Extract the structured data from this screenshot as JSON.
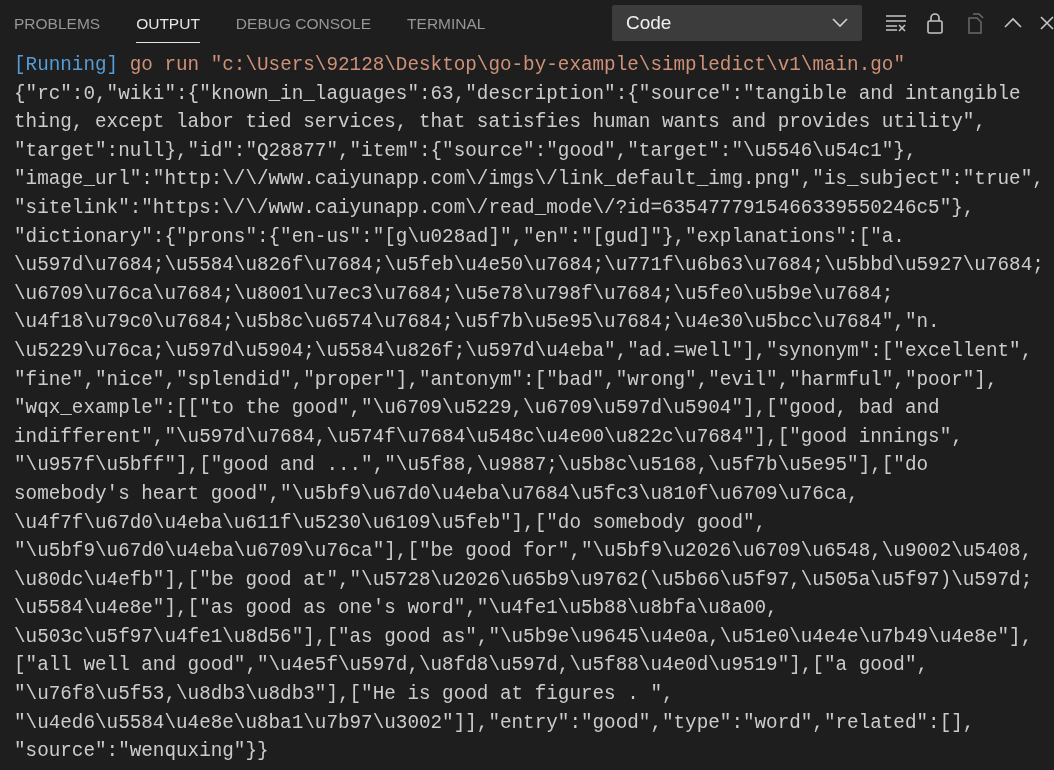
{
  "panel_tabs": [
    {
      "label": "PROBLEMS",
      "selected": false
    },
    {
      "label": "OUTPUT",
      "selected": true
    },
    {
      "label": "DEBUG CONSOLE",
      "selected": false
    },
    {
      "label": "TERMINAL",
      "selected": false
    }
  ],
  "channel_dropdown": {
    "value": "Code"
  },
  "output": {
    "lines": [
      {
        "kind": "running",
        "tag": "[Running]",
        "text": "go run \"c:\\Users\\92128\\Desktop\\go-by-example\\simpledict\\v1\\main.go\""
      },
      {
        "kind": "plain",
        "text": "{\"rc\":0,\"wiki\":{\"known_in_laguages\":63,\"description\":{\"source\":\"tangible and intangible"
      },
      {
        "kind": "plain",
        "text": "thing, except labor tied services, that satisfies human wants and provides utility\","
      },
      {
        "kind": "plain",
        "text": "\"target\":null},\"id\":\"Q28877\",\"item\":{\"source\":\"good\",\"target\":\"\\u5546\\u54c1\"},"
      },
      {
        "kind": "plain",
        "text": "\"image_url\":\"http:\\/\\/www.caiyunapp.com\\/imgs\\/link_default_img.png\",\"is_subject\":\"true\","
      },
      {
        "kind": "plain",
        "text": "\"sitelink\":\"https:\\/\\/www.caiyunapp.com\\/read_mode\\/?id=6354777915466339550246c5\"},"
      },
      {
        "kind": "plain",
        "text": "\"dictionary\":{\"prons\":{\"en-us\":\"[g\\u028ad]\",\"en\":\"[gud]\"},\"explanations\":[\"a."
      },
      {
        "kind": "plain",
        "text": "\\u597d\\u7684;\\u5584\\u826f\\u7684;\\u5feb\\u4e50\\u7684;\\u771f\\u6b63\\u7684;\\u5bbd\\u5927\\u7684;"
      },
      {
        "kind": "plain",
        "text": "\\u6709\\u76ca\\u7684;\\u8001\\u7ec3\\u7684;\\u5e78\\u798f\\u7684;\\u5fe0\\u5b9e\\u7684;"
      },
      {
        "kind": "plain",
        "text": "\\u4f18\\u79c0\\u7684;\\u5b8c\\u6574\\u7684;\\u5f7b\\u5e95\\u7684;\\u4e30\\u5bcc\\u7684\",\"n."
      },
      {
        "kind": "plain",
        "text": "\\u5229\\u76ca;\\u597d\\u5904;\\u5584\\u826f;\\u597d\\u4eba\",\"ad.=well\"],\"synonym\":[\"excellent\","
      },
      {
        "kind": "plain",
        "text": "\"fine\",\"nice\",\"splendid\",\"proper\"],\"antonym\":[\"bad\",\"wrong\",\"evil\",\"harmful\",\"poor\"],"
      },
      {
        "kind": "plain",
        "text": "\"wqx_example\":[[\"to the good\",\"\\u6709\\u5229,\\u6709\\u597d\\u5904\"],[\"good, bad and"
      },
      {
        "kind": "plain",
        "text": "indifferent\",\"\\u597d\\u7684,\\u574f\\u7684\\u548c\\u4e00\\u822c\\u7684\"],[\"good innings\","
      },
      {
        "kind": "plain",
        "text": "\"\\u957f\\u5bff\"],[\"good and ...\",\"\\u5f88,\\u9887;\\u5b8c\\u5168,\\u5f7b\\u5e95\"],[\"do"
      },
      {
        "kind": "plain",
        "text": "somebody's heart good\",\"\\u5bf9\\u67d0\\u4eba\\u7684\\u5fc3\\u810f\\u6709\\u76ca,"
      },
      {
        "kind": "plain",
        "text": "\\u4f7f\\u67d0\\u4eba\\u611f\\u5230\\u6109\\u5feb\"],[\"do somebody good\","
      },
      {
        "kind": "plain",
        "text": "\"\\u5bf9\\u67d0\\u4eba\\u6709\\u76ca\"],[\"be good for\",\"\\u5bf9\\u2026\\u6709\\u6548,\\u9002\\u5408,"
      },
      {
        "kind": "plain",
        "text": "\\u80dc\\u4efb\"],[\"be good at\",\"\\u5728\\u2026\\u65b9\\u9762(\\u5b66\\u5f97,\\u505a\\u5f97)\\u597d;"
      },
      {
        "kind": "plain",
        "text": "\\u5584\\u4e8e\"],[\"as good as one's word\",\"\\u4fe1\\u5b88\\u8bfa\\u8a00,"
      },
      {
        "kind": "plain",
        "text": "\\u503c\\u5f97\\u4fe1\\u8d56\"],[\"as good as\",\"\\u5b9e\\u9645\\u4e0a,\\u51e0\\u4e4e\\u7b49\\u4e8e\"],"
      },
      {
        "kind": "plain",
        "text": "[\"all well and good\",\"\\u4e5f\\u597d,\\u8fd8\\u597d,\\u5f88\\u4e0d\\u9519\"],[\"a good\","
      },
      {
        "kind": "plain",
        "text": "\"\\u76f8\\u5f53,\\u8db3\\u8db3\"],[\"He is good at figures . \","
      },
      {
        "kind": "plain",
        "text": "\"\\u4ed6\\u5584\\u4e8e\\u8ba1\\u7b97\\u3002\"]],\"entry\":\"good\",\"type\":\"word\",\"related\":[],"
      },
      {
        "kind": "plain",
        "text": "\"source\":\"wenquxing\"}}"
      }
    ]
  }
}
